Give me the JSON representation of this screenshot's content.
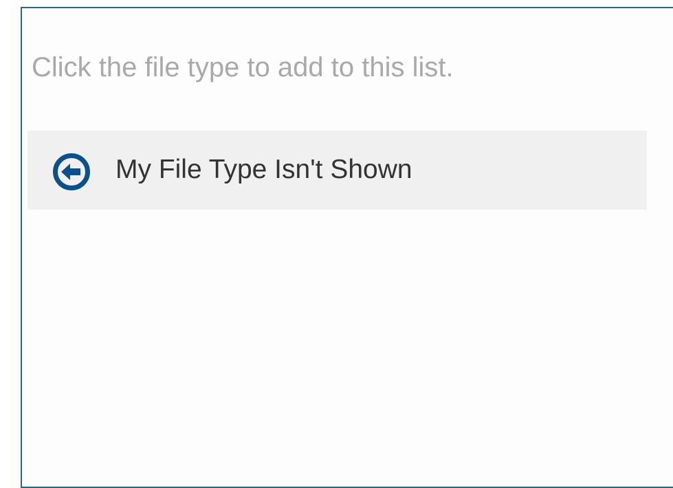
{
  "instructions": "Click the file type to add to this list.",
  "file_type_list": {
    "items": [
      {
        "label": "My File Type Isn't Shown",
        "icon": "arrow-left-circle-icon"
      }
    ]
  },
  "colors": {
    "panel_border": "#2f6585",
    "icon": "#0b4f8c",
    "item_background": "#f0f0f0",
    "instruction_text": "#a9a9a9",
    "item_text": "#333333"
  }
}
